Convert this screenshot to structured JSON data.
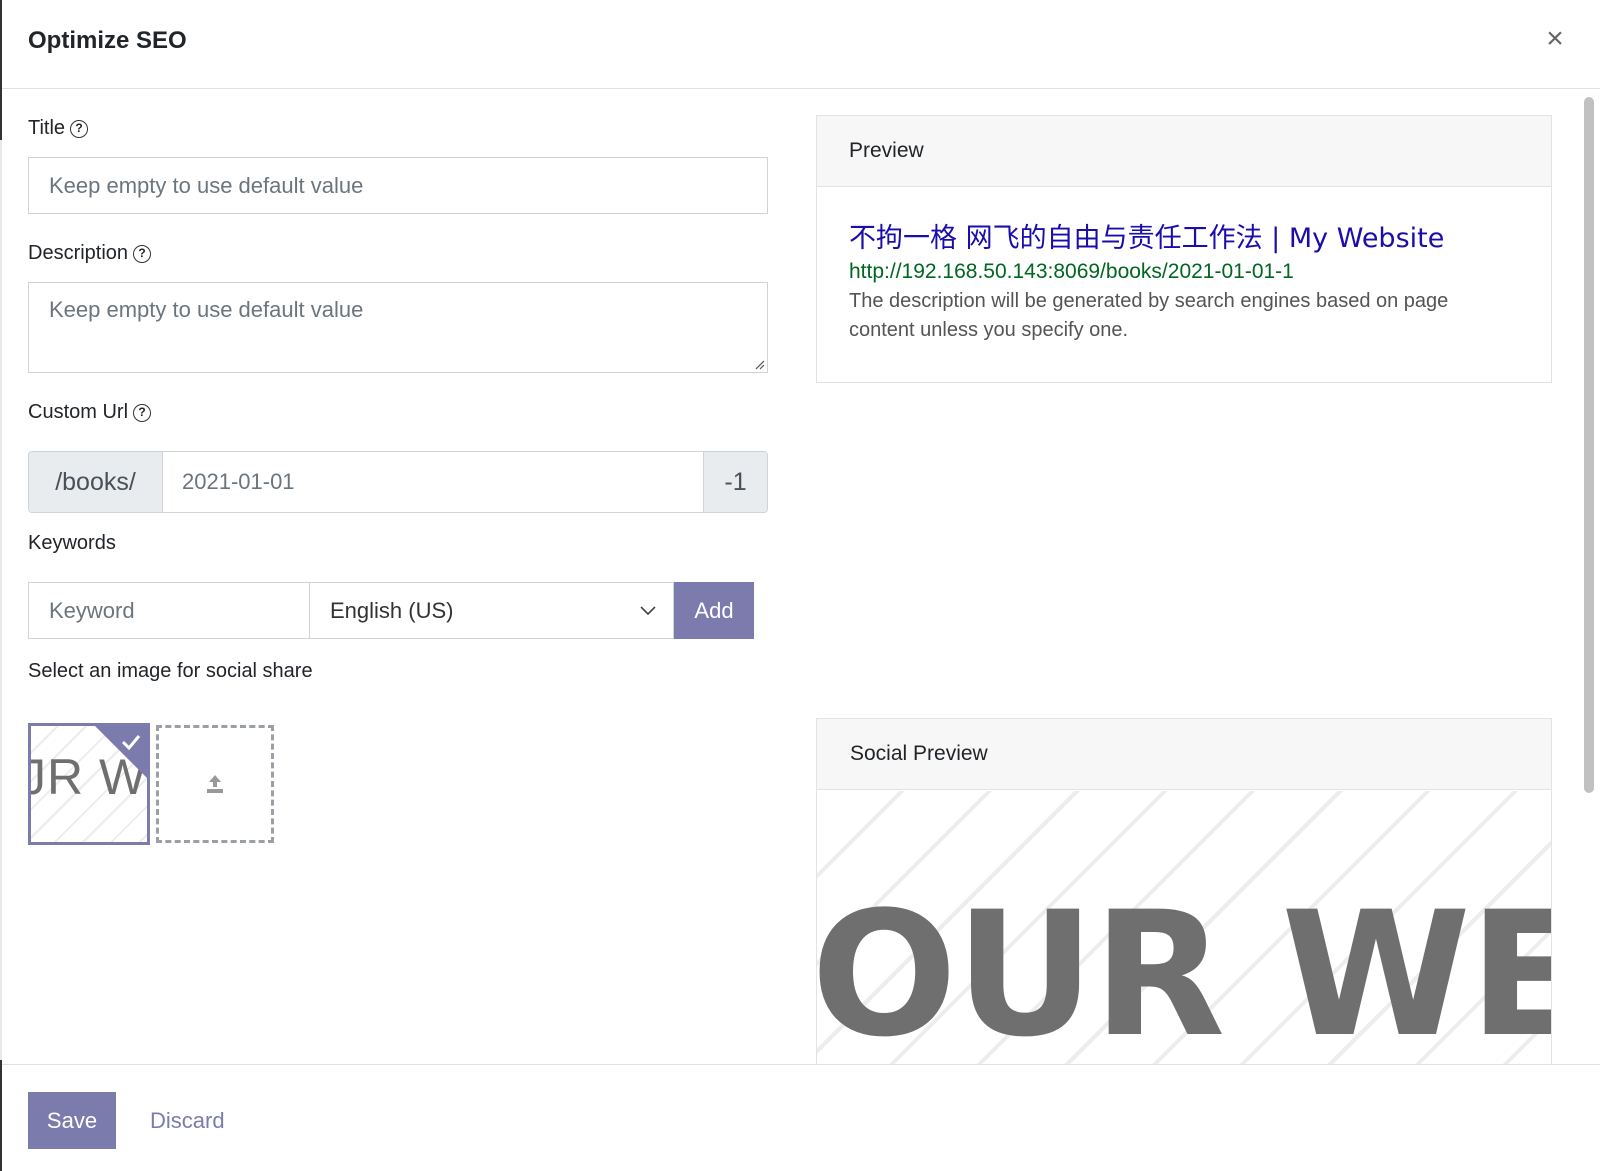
{
  "dialog": {
    "title": "Optimize SEO",
    "close_icon": "close-icon"
  },
  "form": {
    "title": {
      "label": "Title",
      "placeholder": "Keep empty to use default value"
    },
    "description": {
      "label": "Description",
      "placeholder": "Keep empty to use default value"
    },
    "custom_url": {
      "label": "Custom Url",
      "prefix": "/books/",
      "placeholder": "2021-01-01",
      "suffix": "-1"
    },
    "keywords": {
      "label": "Keywords",
      "input_placeholder": "Keyword",
      "language_selected": "English (US)",
      "add_label": "Add"
    },
    "social_image": {
      "label": "Select an image for social share",
      "thumbnail_text": "JR W",
      "upload_icon": "upload-icon"
    }
  },
  "preview": {
    "header": "Preview",
    "title": "不拘一格 网飞的自由与责任工作法 | My Website",
    "url": "http://192.168.50.143:8069/books/2021-01-01-1",
    "description": "The description will be generated by search engines based on page content unless you specify one."
  },
  "social_preview": {
    "header": "Social Preview",
    "image_text": "OUR WEB"
  },
  "footer": {
    "save_label": "Save",
    "discard_label": "Discard"
  },
  "colors": {
    "accent": "#7c7bad",
    "link_title": "#1a0dab",
    "link_url": "#006621"
  }
}
